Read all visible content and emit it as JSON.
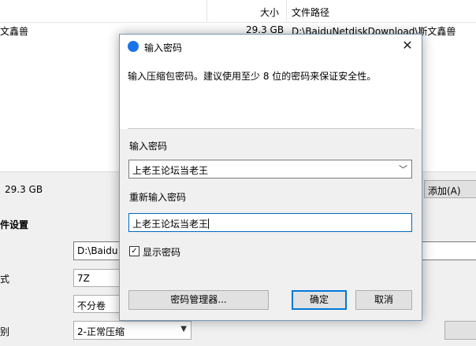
{
  "background": {
    "columns": {
      "size": "大小",
      "path": "文件路径"
    },
    "row": {
      "name": "文鑫兽",
      "size": "29.3 GB",
      "path": "D:\\BaiduNetdiskDownload\\斯文鑫兽"
    },
    "total_size": "29.3 GB",
    "add_button": "添加(A)",
    "section_title": "件设置",
    "output_path": "D:\\Baidu",
    "format_label": "式",
    "format_value": "7Z",
    "split_value": "不分卷",
    "level_label": "别",
    "level_value": "2-正常压缩"
  },
  "dialog": {
    "title": "输入密码",
    "close_glyph": "✕",
    "info": "输入压缩包密码。建议使用至少 8 位的密码来保证安全性。",
    "password_label": "输入密码",
    "password_value": "上老王论坛当老王",
    "reenter_label": "重新输入密码",
    "reenter_value": "上老王论坛当老王",
    "show_password_label": "显示密码",
    "show_password_checked": true,
    "manager_button": "密码管理器...",
    "ok_button": "确定",
    "cancel_button": "取消"
  },
  "icons": {
    "title_icon": "app-logo-icon",
    "dropdown": "chevron-down-icon",
    "check": "checkmark-icon"
  },
  "colors": {
    "accent": "#0078d7",
    "title_icon_blue": "#1a73e8"
  }
}
